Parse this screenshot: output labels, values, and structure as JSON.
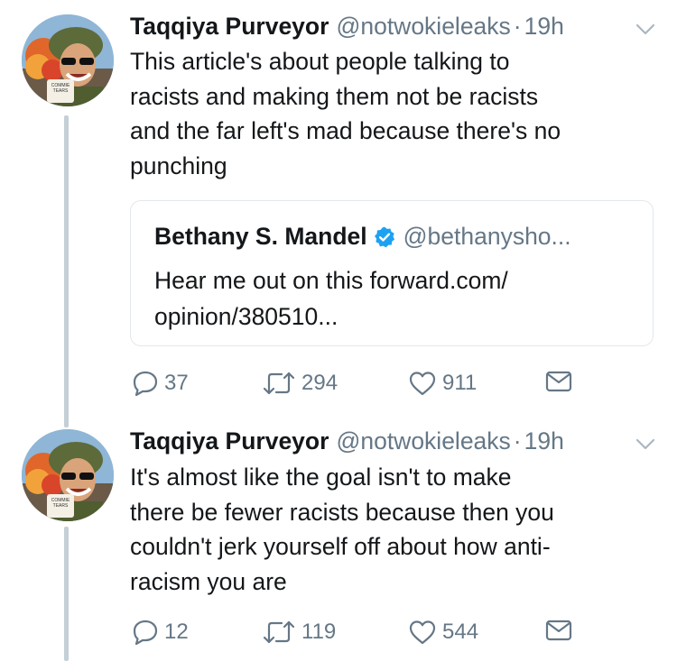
{
  "tweets": [
    {
      "name": "Taqqiya Purveyor",
      "handle": "@notwokieleaks",
      "time": "19h",
      "text": "This article's about people talking to\nracists and making them not be racists\nand the far left's mad because there's no\npunching",
      "mug_text": "COMMIE TEARS",
      "quote": {
        "name": "Bethany S. Mandel",
        "handle": "@bethanysho...",
        "text": "Hear me out on this  forward.com/\nopinion/380510..."
      },
      "replies": "37",
      "retweets": "294",
      "likes": "911"
    },
    {
      "name": "Taqqiya Purveyor",
      "handle": "@notwokieleaks",
      "time": "19h",
      "text": "It's almost like the goal isn't to make\nthere be fewer racists because then you\ncouldn't jerk yourself off about how anti-\nracism you are",
      "mug_text": "COMMIE TEARS",
      "replies": "12",
      "retweets": "119",
      "likes": "544"
    }
  ],
  "colors": {
    "text": "#14171a",
    "secondary": "#657786",
    "thread_line": "#c4cfd6",
    "verified": "#1da1f2",
    "border": "#e1e8ed"
  },
  "icons": [
    "chevron-down-icon",
    "verified-badge-icon",
    "reply-icon",
    "retweet-icon",
    "like-icon",
    "direct-message-icon"
  ]
}
